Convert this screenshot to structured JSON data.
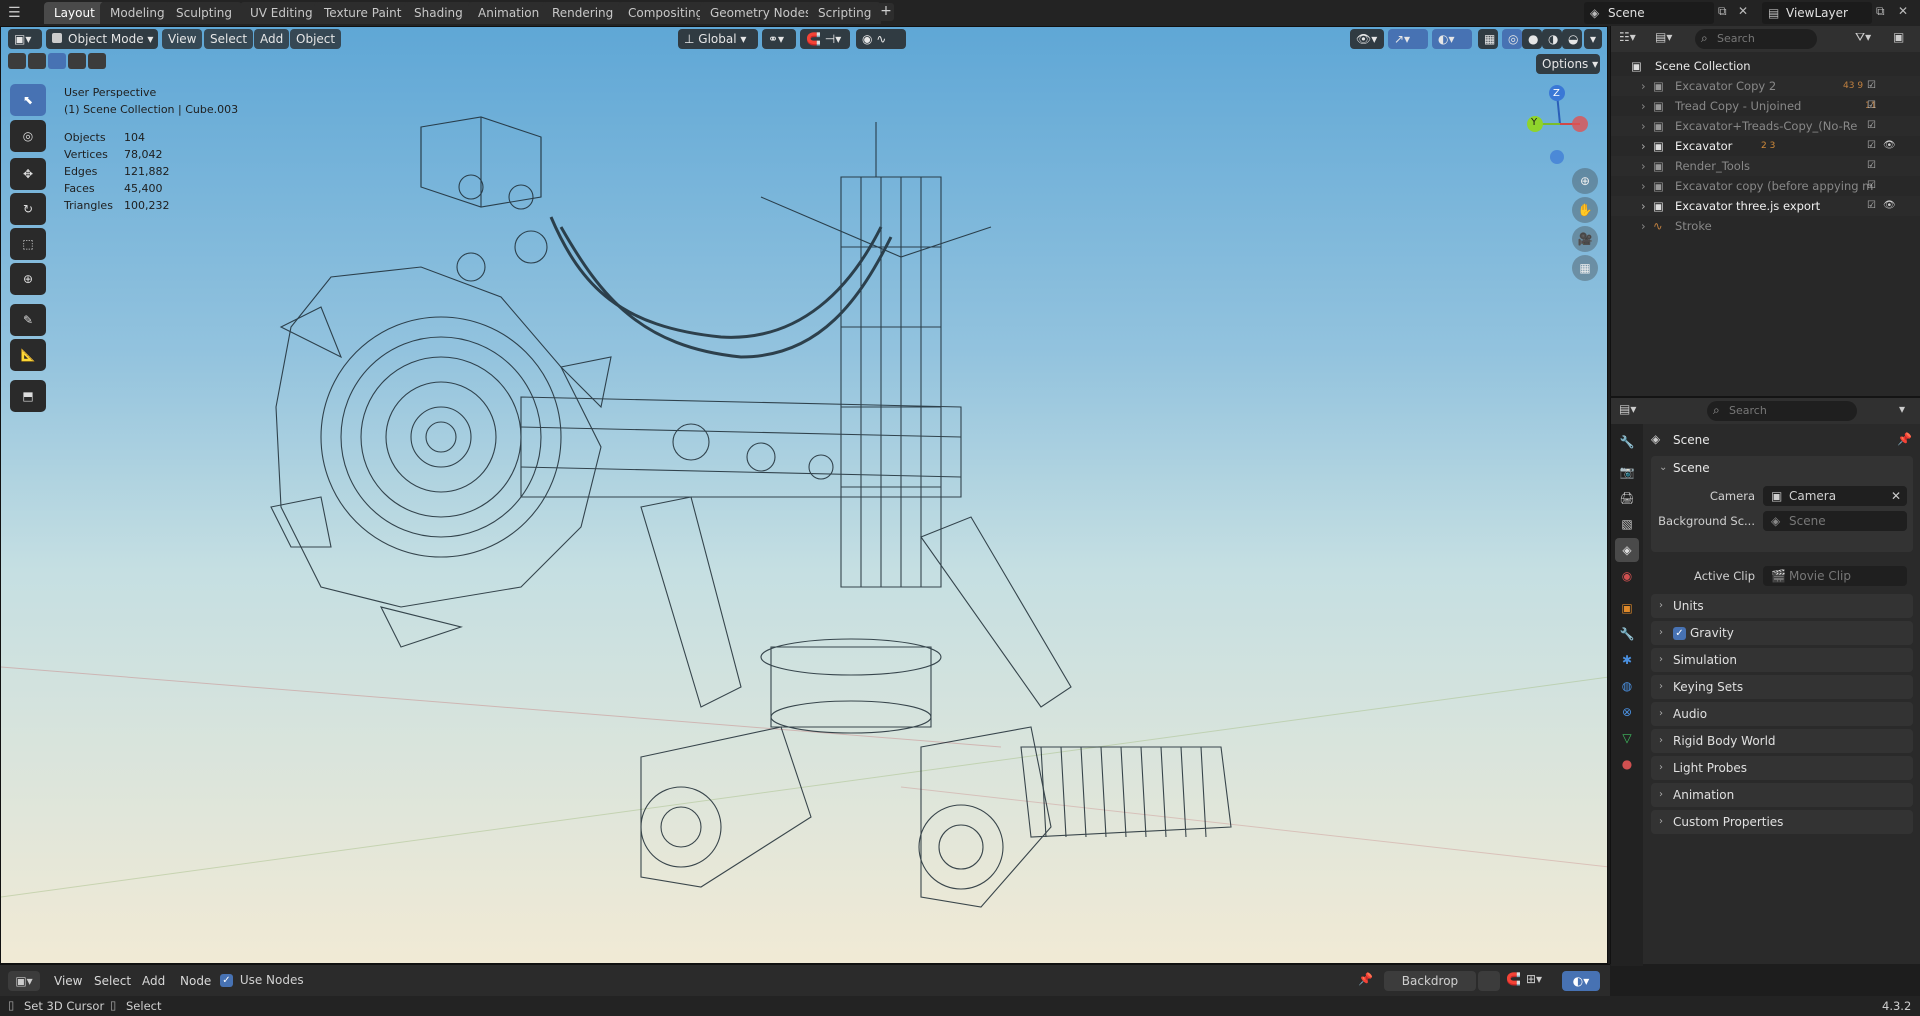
{
  "workspace_tabs": [
    "Layout",
    "Modeling",
    "Sculpting",
    "UV Editing",
    "Texture Paint",
    "Shading",
    "Animation",
    "Rendering",
    "Compositing",
    "Geometry Nodes",
    "Scripting"
  ],
  "active_tab": "Layout",
  "scene_field": "Scene",
  "viewlayer_field": "ViewLayer",
  "viewport": {
    "mode": "Object Mode",
    "menus": [
      "View",
      "Select",
      "Add",
      "Object"
    ],
    "orientation": "Global",
    "options_label": "Options",
    "perspective_label": "User Perspective",
    "collection_label": "(1) Scene Collection | Cube.003",
    "stats": [
      {
        "label": "Objects",
        "value": "104"
      },
      {
        "label": "Vertices",
        "value": "78,042"
      },
      {
        "label": "Edges",
        "value": "121,882"
      },
      {
        "label": "Faces",
        "value": "45,400"
      },
      {
        "label": "Triangles",
        "value": "100,232"
      }
    ],
    "gizmo_axes": {
      "z": "Z",
      "y": "Y"
    }
  },
  "outliner": {
    "search_placeholder": "Search",
    "root": "Scene Collection",
    "items": [
      {
        "name": "Excavator Copy 2",
        "badges": "43 9",
        "dim": true
      },
      {
        "name": "Tread Copy - Unjoined",
        "badges": "11",
        "dim": true
      },
      {
        "name": "Excavator+Treads-Copy_(No-Re",
        "badges": "",
        "dim": true
      },
      {
        "name": "Excavator",
        "badges": "2 3",
        "dim": false
      },
      {
        "name": "Render_Tools",
        "badges": "",
        "dim": true
      },
      {
        "name": "Excavator copy (before appying m",
        "badges": "",
        "dim": true
      },
      {
        "name": "Excavator three.js export",
        "badges": "",
        "dim": false
      },
      {
        "name": "Stroke",
        "badges": "",
        "dim": true
      }
    ]
  },
  "properties": {
    "search_placeholder": "Search",
    "context_title": "Scene",
    "scene_panel": {
      "title": "Scene",
      "camera_label": "Camera",
      "camera_value": "Camera",
      "background_label": "Background Sc...",
      "background_value": "Scene",
      "clip_label": "Active Clip",
      "clip_value": "Movie Clip"
    },
    "panels": [
      "Units",
      "Gravity",
      "Simulation",
      "Keying Sets",
      "Audio",
      "Rigid Body World",
      "Light Probes",
      "Animation",
      "Custom Properties"
    ]
  },
  "bottom_editor": {
    "menus": [
      "View",
      "Select",
      "Add",
      "Node"
    ],
    "use_nodes_label": "Use Nodes",
    "backdrop_label": "Backdrop"
  },
  "statusbar": {
    "left_action": "Set 3D Cursor",
    "right_action": "Select",
    "version": "4.3.2"
  }
}
